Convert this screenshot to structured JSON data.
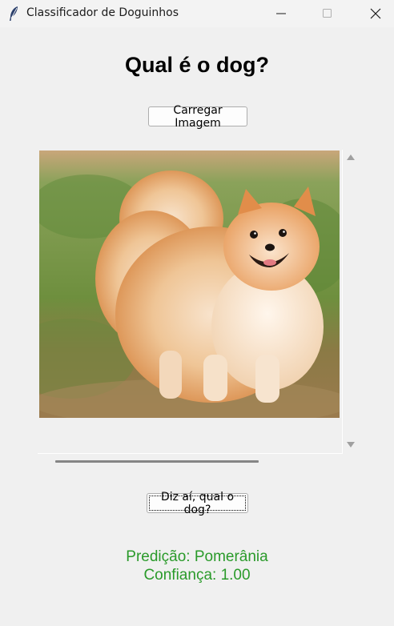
{
  "window": {
    "title": "Classificador de Doguinhos",
    "icon": "feather-icon",
    "controls": [
      "minimize-icon",
      "maximize-icon",
      "close-icon"
    ]
  },
  "main": {
    "heading": "Qual é o dog?",
    "load_button_label": "Carregar Imagem",
    "predict_button_label": "Diz aí, qual o dog?",
    "image": {
      "subject": "pomeranian-photo"
    },
    "horizontal_scroll": {
      "visible_fraction": 0.67
    }
  },
  "result": {
    "prediction": "Predição: Pomerânia",
    "confidence": "Confiança: 1.00",
    "color": "#2a9a2a"
  }
}
